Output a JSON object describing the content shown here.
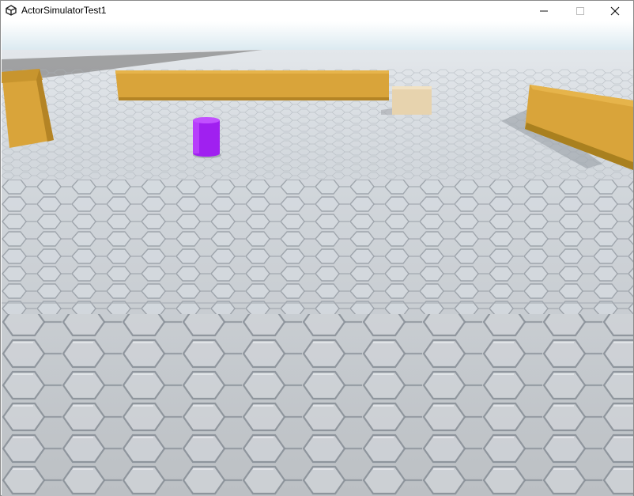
{
  "window": {
    "title": "ActorSimulatorTest1",
    "icon": "unity-logo-icon",
    "controls": [
      "minimize-icon",
      "maximize-icon",
      "close-icon"
    ]
  },
  "scene": {
    "ground": "cobblestone-floor",
    "objects": [
      {
        "kind": "wall",
        "color": "#d9a43a"
      },
      {
        "kind": "wall",
        "color": "#d9a43a"
      },
      {
        "kind": "wall",
        "color": "#d9a43a"
      },
      {
        "kind": "cube",
        "color": "#e7d3ae"
      },
      {
        "kind": "cylinder",
        "color": "#a020f0"
      }
    ],
    "colors": {
      "sky_top": "#ffffff",
      "sky_horizon": "#d8e8ef",
      "floor_far": "#dde3e9",
      "floor_near": "#b9bdc1",
      "stone_edge": "#8f969e",
      "wall": "#d9a43a",
      "wall_shade": "#a9801f",
      "cube": "#e7d3ae",
      "cylinder": "#a020f0"
    }
  }
}
